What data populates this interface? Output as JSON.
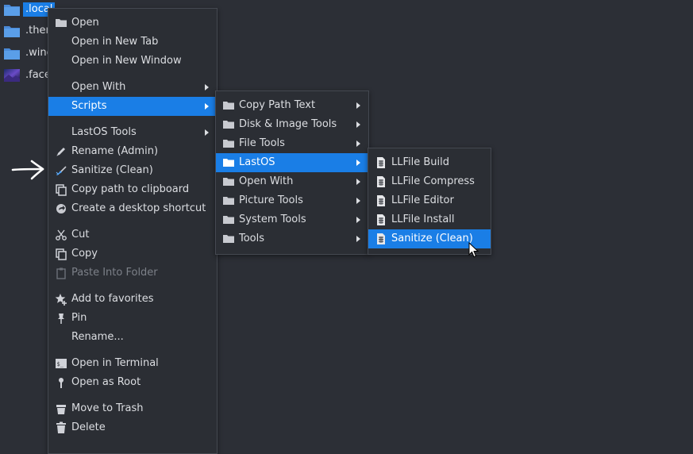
{
  "files": [
    {
      "name": ".local",
      "selected": true,
      "icon": "folder-icon"
    },
    {
      "name": ".then",
      "selected": false,
      "icon": "folder-icon"
    },
    {
      "name": ".wine",
      "selected": false,
      "icon": "folder-icon"
    },
    {
      "name": ".face",
      "selected": false,
      "icon": "image-icon"
    }
  ],
  "context_menu": {
    "open": "Open",
    "open_new_tab": "Open in New Tab",
    "open_new_window": "Open in New Window",
    "open_with": "Open With",
    "scripts": "Scripts",
    "lastos_tools": "LastOS Tools",
    "rename_admin": "Rename (Admin)",
    "sanitize": "Sanitize (Clean)",
    "copy_path": "Copy path to clipboard",
    "desktop_shortcut": "Create a desktop shortcut",
    "cut": "Cut",
    "copy": "Copy",
    "paste_into_folder": "Paste Into Folder",
    "add_favorites": "Add to favorites",
    "pin": "Pin",
    "rename": "Rename...",
    "open_terminal": "Open in Terminal",
    "open_root": "Open as Root",
    "move_trash": "Move to Trash",
    "delete": "Delete"
  },
  "scripts_menu": {
    "items": [
      "Copy Path Text",
      "Disk & Image Tools",
      "File Tools",
      "LastOS",
      "Open With",
      "Picture Tools",
      "System Tools",
      "Tools"
    ],
    "active": "LastOS"
  },
  "lastos_menu": {
    "items": [
      "LLFile Build",
      "LLFile Compress",
      "LLFile Editor",
      "LLFile Install",
      "Sanitize (Clean)"
    ],
    "active": "Sanitize (Clean)"
  },
  "colors": {
    "background": "#2c2f36",
    "menu_bg": "#2b2e34",
    "highlight": "#1a7ee6",
    "folder": "#5a9ee8",
    "text": "#dcdee2",
    "disabled_text": "#7c8088"
  }
}
